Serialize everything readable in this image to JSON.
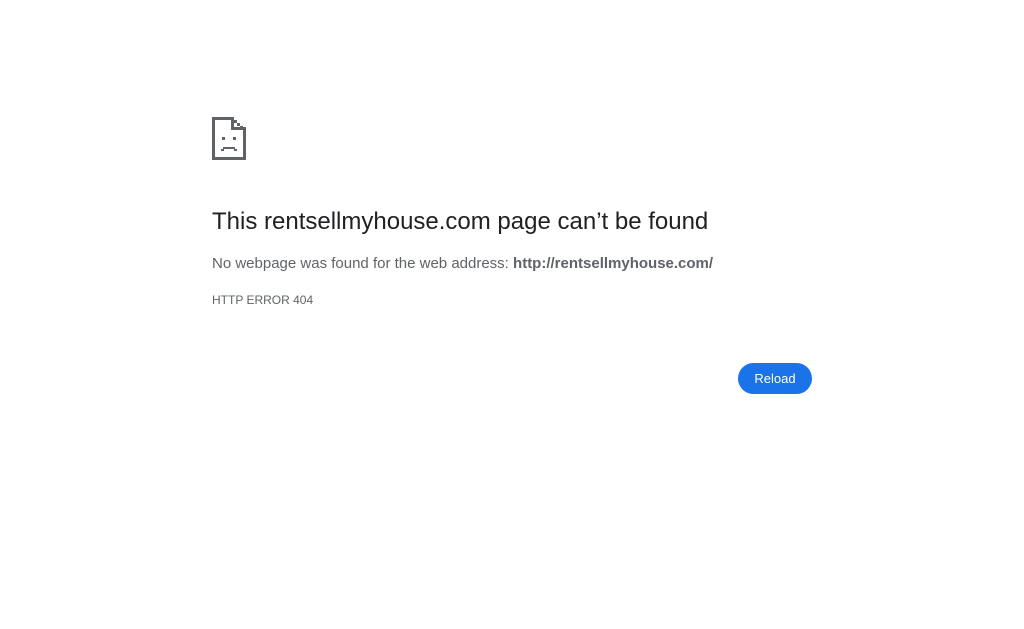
{
  "icon": "sad-page-icon",
  "title": "This rentsellmyhouse.com page can’t be found",
  "summary": {
    "prefix": "No webpage was found for the web address: ",
    "url": "http://rentsellmyhouse.com/"
  },
  "error_code": "HTTP ERROR 404",
  "reload_label": "Reload",
  "colors": {
    "button": "#1a73e8",
    "title": "#202124",
    "secondary_text": "#5f6368",
    "icon": "#5f6368"
  }
}
